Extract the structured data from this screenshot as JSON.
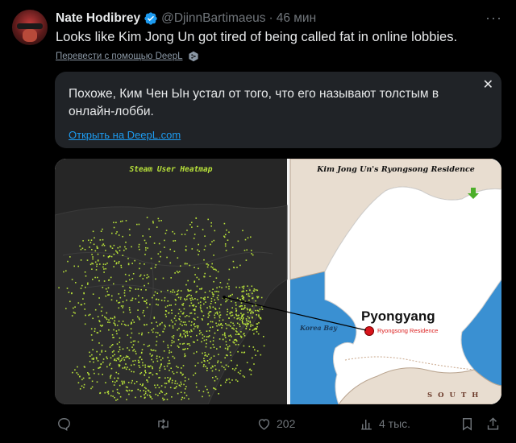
{
  "tweet": {
    "author_name": "Nate Hodibrey",
    "handle": "@DjinnBartimaeus",
    "separator": "·",
    "time": "46 мин",
    "text": "Looks like Kim Jong Un got tired of being called fat in online lobbies.",
    "translate_link": "Перевести с помощью DeepL",
    "verified": true
  },
  "translation": {
    "text": "Похоже, Ким Чен Ын устал от того, что его называют толстым в онлайн-лобби.",
    "open_link": "Открыть на DeepL.com"
  },
  "media": {
    "left_title": "Steam User Heatmap",
    "right_title": "Kim Jong Un's Ryongsong Residence",
    "city": "Pyongyang",
    "residence_label": "Ryongsong Residence",
    "bay_label": "Korea Bay",
    "south_label": "SOUTH",
    "colors": {
      "heat": "#b8e23a",
      "sea": "#3a90d2",
      "land": "#ffffff",
      "neighbor": "#e8ddd0",
      "marker": "#d8141b"
    }
  },
  "actions": {
    "reply_count": "",
    "retweet_count": "",
    "like_count": "202",
    "views_count": "4 тыс.",
    "icons": [
      "reply-icon",
      "retweet-icon",
      "like-icon",
      "views-icon",
      "bookmark-icon",
      "share-icon"
    ]
  }
}
